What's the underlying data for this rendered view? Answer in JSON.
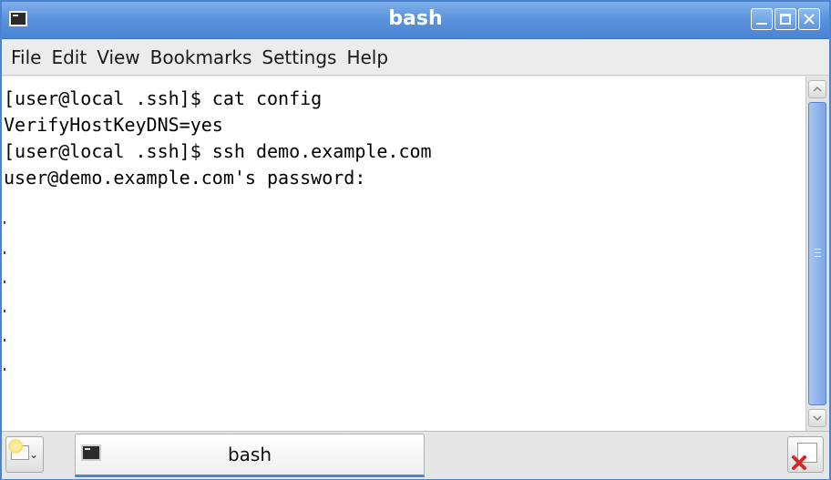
{
  "window": {
    "title": "bash"
  },
  "menu": {
    "items": [
      "File",
      "Edit",
      "View",
      "Bookmarks",
      "Settings",
      "Help"
    ]
  },
  "terminal": {
    "lines": [
      "[user@local .ssh]$ cat config",
      "VerifyHostKeyDNS=yes",
      "[user@local .ssh]$ ssh demo.example.com",
      "user@demo.example.com's password:"
    ]
  },
  "tabs": [
    {
      "label": "bash",
      "icon": "terminal-icon",
      "active": true
    }
  ],
  "colors": {
    "titlebar": "#5b93dd",
    "accent": "#4a83d0",
    "background": "#ffffff",
    "text": "#000000"
  }
}
